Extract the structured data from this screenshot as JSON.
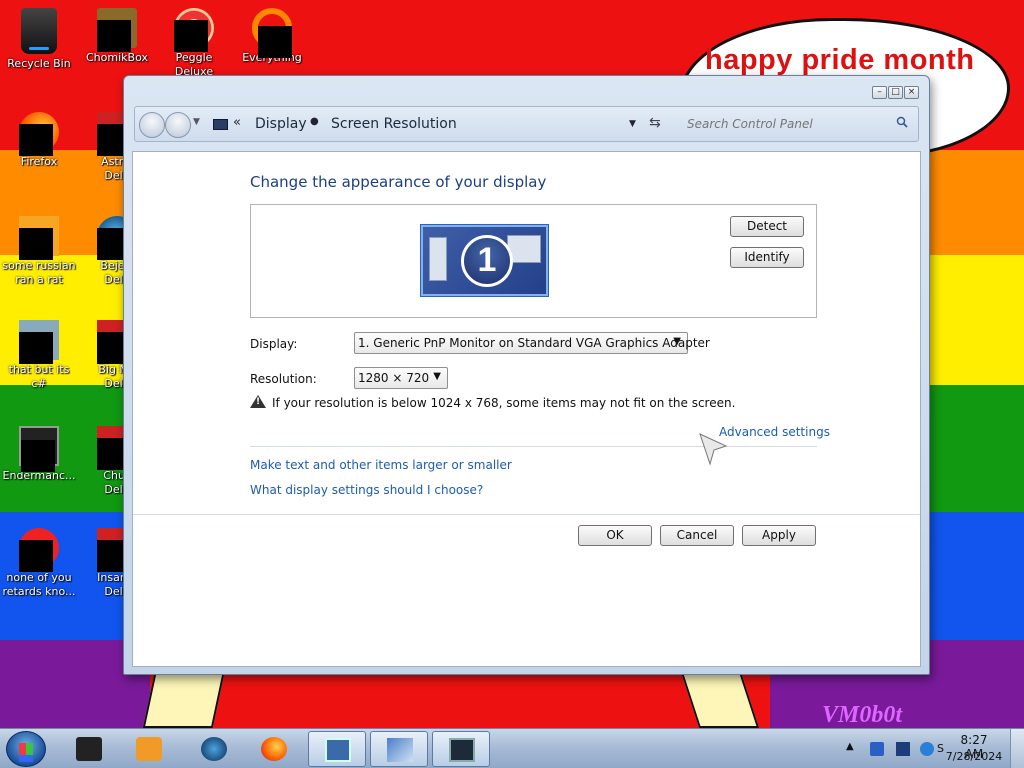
{
  "desktop": {
    "bubble_text": "happy pride month",
    "watermark": "VM0b0t",
    "icons": [
      {
        "label": "Recycle Bin"
      },
      {
        "label": "ChomikBox"
      },
      {
        "label": "Peggle Deluxe"
      },
      {
        "label": "Everything"
      },
      {
        "label": "Firefox"
      },
      {
        "label": "Astrol\nDelu"
      },
      {
        "label": "some russian\nran a rat"
      },
      {
        "label": "Bejew\nDelu"
      },
      {
        "label": "that but its c#"
      },
      {
        "label": "Big Mo\nDelu"
      },
      {
        "label": "Endermanc..."
      },
      {
        "label": "Chuz\nDelu"
      },
      {
        "label": "none of you\nretards kno..."
      },
      {
        "label": "Insaniq\nDelu"
      }
    ]
  },
  "window": {
    "breadcrumb": [
      "Display",
      "Screen Resolution"
    ],
    "search_placeholder": "Search Control Panel",
    "title": "Change the appearance of your display",
    "monitor_number": "1",
    "detect_label": "Detect",
    "identify_label": "Identify",
    "display_label": "Display:",
    "display_value": "1. Generic PnP Monitor on Standard VGA Graphics Adapter",
    "resolution_label": "Resolution:",
    "resolution_value": "1280 × 720",
    "warning": "If your resolution is below 1024 x 768, some items may not fit on the screen.",
    "advanced_link": "Advanced settings",
    "links": [
      "Make text and other items larger or smaller",
      "What display settings should I choose?"
    ],
    "ok_label": "OK",
    "cancel_label": "Cancel",
    "apply_label": "Apply"
  },
  "taskbar": {
    "time": "8:27 AM",
    "date": "7/28/2024",
    "tray_letter": "S"
  },
  "colors": {
    "link": "#1c5bb5",
    "title": "#1b3f86",
    "bubble_text": "#dd1111"
  }
}
